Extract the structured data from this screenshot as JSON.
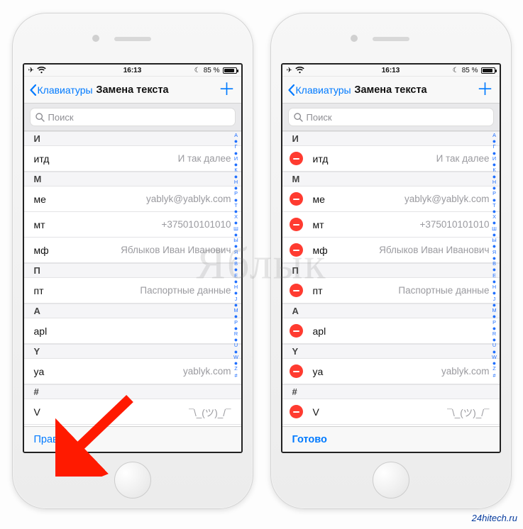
{
  "status": {
    "time": "16:13",
    "battery_pct": "85 %"
  },
  "nav": {
    "back_label": "Клавиатуры",
    "title": "Замена текста"
  },
  "search": {
    "placeholder": "Поиск"
  },
  "sections": [
    {
      "header": "И",
      "items": [
        {
          "shortcut": "итд",
          "value": "И так далее"
        }
      ]
    },
    {
      "header": "М",
      "items": [
        {
          "shortcut": "ме",
          "value": "yablyk@yablyk.com"
        },
        {
          "shortcut": "мт",
          "value": "+375010101010"
        },
        {
          "shortcut": "мф",
          "value": "Яблыков Иван Иванович"
        }
      ]
    },
    {
      "header": "П",
      "items": [
        {
          "shortcut": "пт",
          "value": "Паспортные данные"
        }
      ]
    },
    {
      "header": "A",
      "items": [
        {
          "shortcut": "apl",
          "value": ""
        }
      ]
    },
    {
      "header": "Y",
      "items": [
        {
          "shortcut": "ya",
          "value": "yablyk.com"
        }
      ]
    },
    {
      "header": "#",
      "items": [
        {
          "shortcut": "V",
          "value": "¯\\_(ツ)_/¯"
        }
      ]
    }
  ],
  "index_letters": [
    "А",
    "●",
    "Г",
    "●",
    "И",
    "●",
    "К",
    "●",
    "Н",
    "●",
    "Р",
    "●",
    "Т",
    "●",
    "Х",
    "●",
    "Ш",
    "●",
    "Ы",
    "●",
    "Я",
    "●",
    "B",
    "●",
    "E",
    "●",
    "H",
    "●",
    "J",
    "●",
    "M",
    "●",
    "P",
    "●",
    "R",
    "●",
    "U",
    "●",
    "W",
    "●",
    "Z",
    "#"
  ],
  "toolbar": {
    "left_edit_label": "Править",
    "right_done_label": "Готово"
  },
  "watermark": "Яблык",
  "credit": "24hitech.ru",
  "indices": {
    "apl_section": 3,
    "apl_item": 0
  }
}
